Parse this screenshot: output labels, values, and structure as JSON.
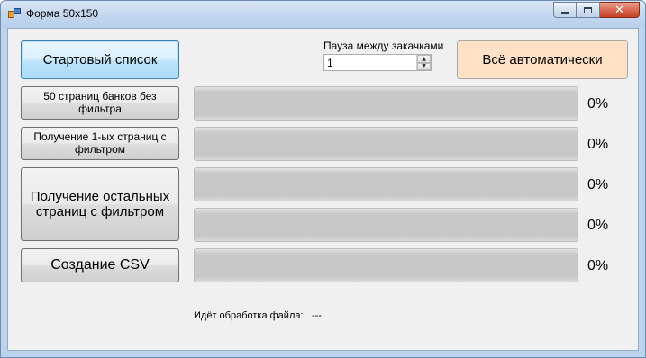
{
  "window": {
    "title": "Форма 50x150",
    "close_glyph": "✕"
  },
  "buttons": {
    "start_list": "Стартовый список",
    "banks_no_filter": "50 страниц банков без фильтра",
    "first_pages_filter": "Получение 1-ых страниц с фильтром",
    "rest_pages_filter": "Получение остальных страниц с фильтром",
    "create_csv": "Создание CSV",
    "all_auto": "Всё автоматически"
  },
  "pause": {
    "label": "Пауза между закачками",
    "value": "1",
    "up_glyph": "▲",
    "down_glyph": "▼"
  },
  "progress": [
    {
      "percent": 0,
      "label": "0%"
    },
    {
      "percent": 0,
      "label": "0%"
    },
    {
      "percent": 0,
      "label": "0%"
    },
    {
      "percent": 0,
      "label": "0%"
    },
    {
      "percent": 0,
      "label": "0%"
    }
  ],
  "status": {
    "label": "Идёт обработка файла:",
    "value": "---"
  },
  "colors": {
    "auto_button_bg": "#ffe2c5",
    "default_button_border": "#3c7fb1",
    "client_bg": "#f0f0f0"
  }
}
